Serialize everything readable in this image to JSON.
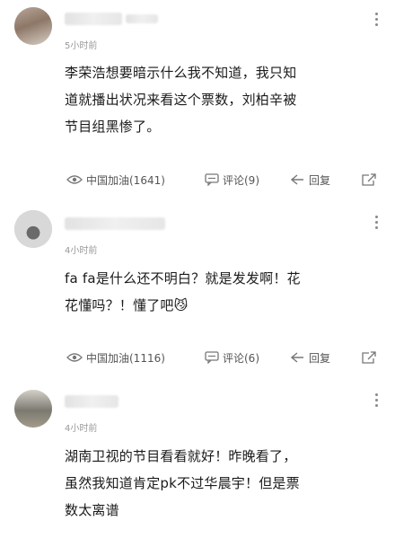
{
  "comments": [
    {
      "time": "5小时前",
      "text": "李荣浩想要暗示什么我不知道，我只知道就播出状况来看这个票数，刘柏辛被节目组黑惨了。",
      "line1": "李荣浩想要暗示什么我不知道，我只知",
      "line2": "道就播出状况来看这个票数，刘柏辛被",
      "line3": "节目组黑惨了。",
      "like_label": "中国加油(1641)",
      "comment_label": "评论(9)",
      "reply_label": "回复"
    },
    {
      "time": "4小时前",
      "line1": "fa fa是什么还不明白？就是发发啊！花",
      "line2": "花懂吗？！懂了吧😼",
      "like_label": "中国加油(1116)",
      "comment_label": "评论(6)",
      "reply_label": "回复"
    },
    {
      "time": "4小时前",
      "line1": "湖南卫视的节目看看就好！昨晚看了，",
      "line2": "虽然我知道肯定pk不过华晨宇！但是票",
      "line3": "数太离谱"
    }
  ]
}
